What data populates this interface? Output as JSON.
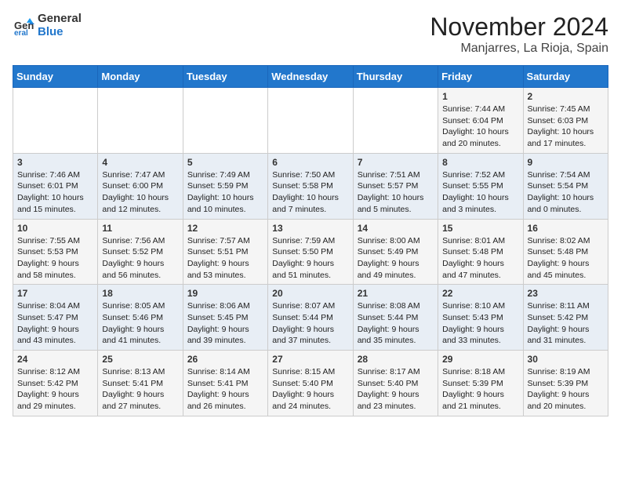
{
  "header": {
    "logo_line1": "General",
    "logo_line2": "Blue",
    "title": "November 2024",
    "subtitle": "Manjarres, La Rioja, Spain"
  },
  "weekdays": [
    "Sunday",
    "Monday",
    "Tuesday",
    "Wednesday",
    "Thursday",
    "Friday",
    "Saturday"
  ],
  "weeks": [
    [
      {
        "day": "",
        "info": ""
      },
      {
        "day": "",
        "info": ""
      },
      {
        "day": "",
        "info": ""
      },
      {
        "day": "",
        "info": ""
      },
      {
        "day": "",
        "info": ""
      },
      {
        "day": "1",
        "info": "Sunrise: 7:44 AM\nSunset: 6:04 PM\nDaylight: 10 hours and 20 minutes."
      },
      {
        "day": "2",
        "info": "Sunrise: 7:45 AM\nSunset: 6:03 PM\nDaylight: 10 hours and 17 minutes."
      }
    ],
    [
      {
        "day": "3",
        "info": "Sunrise: 7:46 AM\nSunset: 6:01 PM\nDaylight: 10 hours and 15 minutes."
      },
      {
        "day": "4",
        "info": "Sunrise: 7:47 AM\nSunset: 6:00 PM\nDaylight: 10 hours and 12 minutes."
      },
      {
        "day": "5",
        "info": "Sunrise: 7:49 AM\nSunset: 5:59 PM\nDaylight: 10 hours and 10 minutes."
      },
      {
        "day": "6",
        "info": "Sunrise: 7:50 AM\nSunset: 5:58 PM\nDaylight: 10 hours and 7 minutes."
      },
      {
        "day": "7",
        "info": "Sunrise: 7:51 AM\nSunset: 5:57 PM\nDaylight: 10 hours and 5 minutes."
      },
      {
        "day": "8",
        "info": "Sunrise: 7:52 AM\nSunset: 5:55 PM\nDaylight: 10 hours and 3 minutes."
      },
      {
        "day": "9",
        "info": "Sunrise: 7:54 AM\nSunset: 5:54 PM\nDaylight: 10 hours and 0 minutes."
      }
    ],
    [
      {
        "day": "10",
        "info": "Sunrise: 7:55 AM\nSunset: 5:53 PM\nDaylight: 9 hours and 58 minutes."
      },
      {
        "day": "11",
        "info": "Sunrise: 7:56 AM\nSunset: 5:52 PM\nDaylight: 9 hours and 56 minutes."
      },
      {
        "day": "12",
        "info": "Sunrise: 7:57 AM\nSunset: 5:51 PM\nDaylight: 9 hours and 53 minutes."
      },
      {
        "day": "13",
        "info": "Sunrise: 7:59 AM\nSunset: 5:50 PM\nDaylight: 9 hours and 51 minutes."
      },
      {
        "day": "14",
        "info": "Sunrise: 8:00 AM\nSunset: 5:49 PM\nDaylight: 9 hours and 49 minutes."
      },
      {
        "day": "15",
        "info": "Sunrise: 8:01 AM\nSunset: 5:48 PM\nDaylight: 9 hours and 47 minutes."
      },
      {
        "day": "16",
        "info": "Sunrise: 8:02 AM\nSunset: 5:48 PM\nDaylight: 9 hours and 45 minutes."
      }
    ],
    [
      {
        "day": "17",
        "info": "Sunrise: 8:04 AM\nSunset: 5:47 PM\nDaylight: 9 hours and 43 minutes."
      },
      {
        "day": "18",
        "info": "Sunrise: 8:05 AM\nSunset: 5:46 PM\nDaylight: 9 hours and 41 minutes."
      },
      {
        "day": "19",
        "info": "Sunrise: 8:06 AM\nSunset: 5:45 PM\nDaylight: 9 hours and 39 minutes."
      },
      {
        "day": "20",
        "info": "Sunrise: 8:07 AM\nSunset: 5:44 PM\nDaylight: 9 hours and 37 minutes."
      },
      {
        "day": "21",
        "info": "Sunrise: 8:08 AM\nSunset: 5:44 PM\nDaylight: 9 hours and 35 minutes."
      },
      {
        "day": "22",
        "info": "Sunrise: 8:10 AM\nSunset: 5:43 PM\nDaylight: 9 hours and 33 minutes."
      },
      {
        "day": "23",
        "info": "Sunrise: 8:11 AM\nSunset: 5:42 PM\nDaylight: 9 hours and 31 minutes."
      }
    ],
    [
      {
        "day": "24",
        "info": "Sunrise: 8:12 AM\nSunset: 5:42 PM\nDaylight: 9 hours and 29 minutes."
      },
      {
        "day": "25",
        "info": "Sunrise: 8:13 AM\nSunset: 5:41 PM\nDaylight: 9 hours and 27 minutes."
      },
      {
        "day": "26",
        "info": "Sunrise: 8:14 AM\nSunset: 5:41 PM\nDaylight: 9 hours and 26 minutes."
      },
      {
        "day": "27",
        "info": "Sunrise: 8:15 AM\nSunset: 5:40 PM\nDaylight: 9 hours and 24 minutes."
      },
      {
        "day": "28",
        "info": "Sunrise: 8:17 AM\nSunset: 5:40 PM\nDaylight: 9 hours and 23 minutes."
      },
      {
        "day": "29",
        "info": "Sunrise: 8:18 AM\nSunset: 5:39 PM\nDaylight: 9 hours and 21 minutes."
      },
      {
        "day": "30",
        "info": "Sunrise: 8:19 AM\nSunset: 5:39 PM\nDaylight: 9 hours and 20 minutes."
      }
    ]
  ]
}
